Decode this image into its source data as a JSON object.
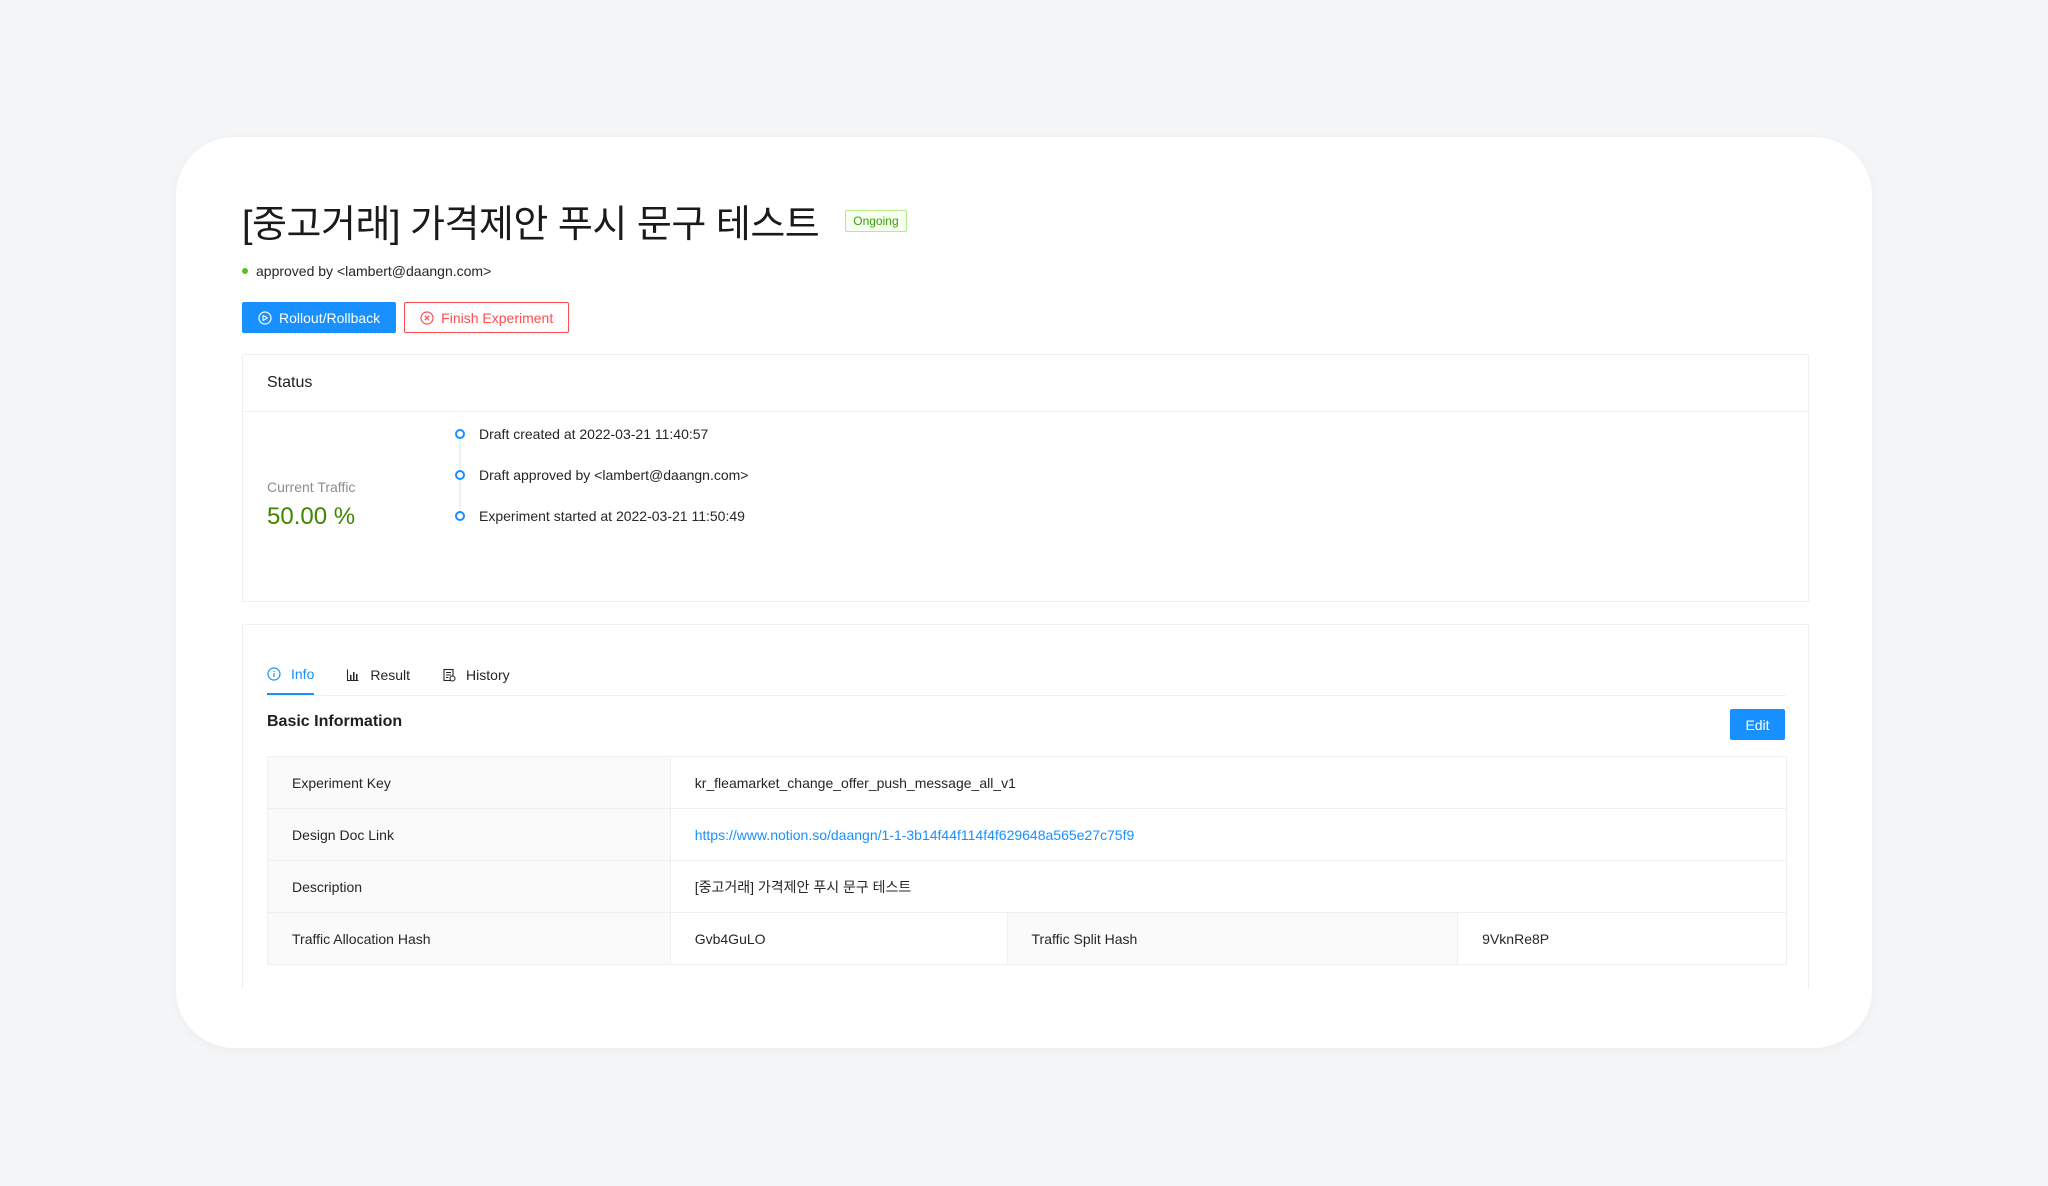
{
  "header": {
    "title": "[중고거래] 가격제안 푸시 문구 테스트",
    "status_badge": "Ongoing",
    "approval": "approved by <lambert@daangn.com>"
  },
  "actions": {
    "rollout_label": "Rollout/Rollback",
    "finish_label": "Finish Experiment"
  },
  "status": {
    "title": "Status",
    "traffic_label": "Current Traffic",
    "traffic_value": "50.00 %",
    "timeline": [
      "Draft created at 2022-03-21 11:40:57",
      "Draft approved by <lambert@daangn.com>",
      "Experiment started at 2022-03-21 11:50:49"
    ]
  },
  "tabs": [
    {
      "label": "Info",
      "icon": "info-icon"
    },
    {
      "label": "Result",
      "icon": "bar-chart-icon"
    },
    {
      "label": "History",
      "icon": "history-icon"
    }
  ],
  "basic_info": {
    "title": "Basic Information",
    "edit_label": "Edit",
    "rows": {
      "experiment_key": {
        "label": "Experiment Key",
        "value": "kr_fleamarket_change_offer_push_message_all_v1"
      },
      "design_doc": {
        "label": "Design Doc Link",
        "value": "https://www.notion.so/daangn/1-1-3b14f44f114f4f629648a565e27c75f9"
      },
      "description": {
        "label": "Description",
        "value": "[중고거래] 가격제안 푸시 문구 테스트"
      },
      "traffic_allocation_hash": {
        "label": "Traffic Allocation Hash",
        "value": "Gvb4GuLO"
      },
      "traffic_split_hash": {
        "label": "Traffic Split Hash",
        "value": "9VknRe8P"
      }
    }
  },
  "colors": {
    "page_bg": "#f4f5f7",
    "primary": "#1890ff",
    "danger": "#ff4d4f",
    "success": "#52c41a",
    "traffic": "#3f8600"
  }
}
